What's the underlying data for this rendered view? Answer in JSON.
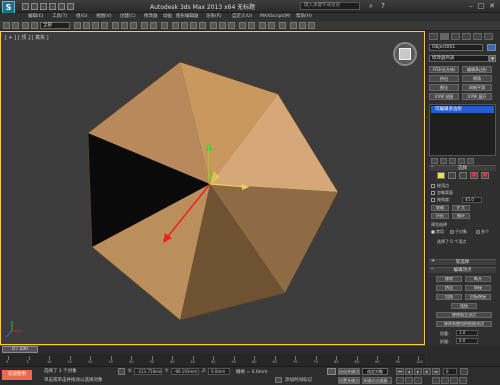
{
  "window": {
    "title": "Autodesk 3ds Max  2013 x64    无标题",
    "search_placeholder": "键入关键字或短语",
    "minimize_glyph": "–",
    "maximize_glyph": "□",
    "close_glyph": "✕"
  },
  "menubar": [
    "编辑(E)",
    "工具(T)",
    "组(G)",
    "视图(V)",
    "创建(C)",
    "修改器",
    "动画",
    "图形编辑器",
    "渲染(R)",
    "自定义(U)",
    "MAXScript(M)",
    "帮助(H)"
  ],
  "toolbar": {
    "selection_filter": "全部"
  },
  "viewport": {
    "label": "[ + ] [ 顶 ] [ 真实 ]",
    "colors": {
      "border_active": "#ffcc33",
      "background": "#3c3c3c",
      "object_base": "#c89a62"
    }
  },
  "command_panel": {
    "object_name": "Object001",
    "object_color": "#2c66d8",
    "modifier_list": "修改器列表",
    "mod_buttons": [
      "FFD(长方体)",
      "编辑多边形",
      "挤出",
      "倒角",
      "细化",
      "网格平滑",
      "UVW 贴图",
      "UVW 展开"
    ],
    "stack_item": "可编辑多边形",
    "selection_rollout": "选择",
    "cb_by_vertex": "按顶点",
    "cb_ignore_backface": "忽略背面",
    "cb_angle_prefix": "按角度:",
    "angle_value": "45.0",
    "shrink": "收缩",
    "grow": "扩大",
    "ring": "环形",
    "loop": "循环",
    "preview_label": "预览选择",
    "radio_off": "禁用",
    "radio_subobject": "子对象",
    "radio_multi": "多个",
    "selected_info": "选择了 0 个顶点",
    "soft_sel_rollout": "软选择",
    "edit_vertices_rollout": "编辑顶点",
    "remove": "移除",
    "break": "断开",
    "extrude": "挤出",
    "weld": "焊接",
    "chamfer": "切角",
    "target_weld": "目标焊接",
    "connect": "连接",
    "remove_isolated": "移除孤立顶点",
    "remove_unused_map": "移除未使用的贴图顶点",
    "weight_label": "权重:",
    "weight_value": "1.0",
    "crease_label": "折缝:",
    "crease_value": "0.0"
  },
  "timeline": {
    "frame_indicator": "0 / 100",
    "ticks": [
      "0",
      "5",
      "10",
      "15",
      "20",
      "25",
      "30",
      "35",
      "40",
      "45",
      "50",
      "55",
      "60",
      "65",
      "70",
      "75",
      "80",
      "85",
      "90",
      "95",
      "100"
    ]
  },
  "statusbar": {
    "welcome": "欢迎使用",
    "selection_count": "选择了 1 个对象",
    "prompt": "单击或单击并拖动以选择对象",
    "x_label": "X:",
    "x_value": "-213.758mm",
    "y_label": "Y:",
    "y_value": "-90.193mm",
    "z_label": "Z:",
    "z_value": "0.0mm",
    "grid": "栅格 = 0.0mm",
    "add_time_tag": "添加时间标记",
    "auto_key": "自动关键点",
    "selected_object": "选定对象",
    "set_key": "设置关键点",
    "key_filters": "关键点过滤器...",
    "frame_value": "0"
  }
}
